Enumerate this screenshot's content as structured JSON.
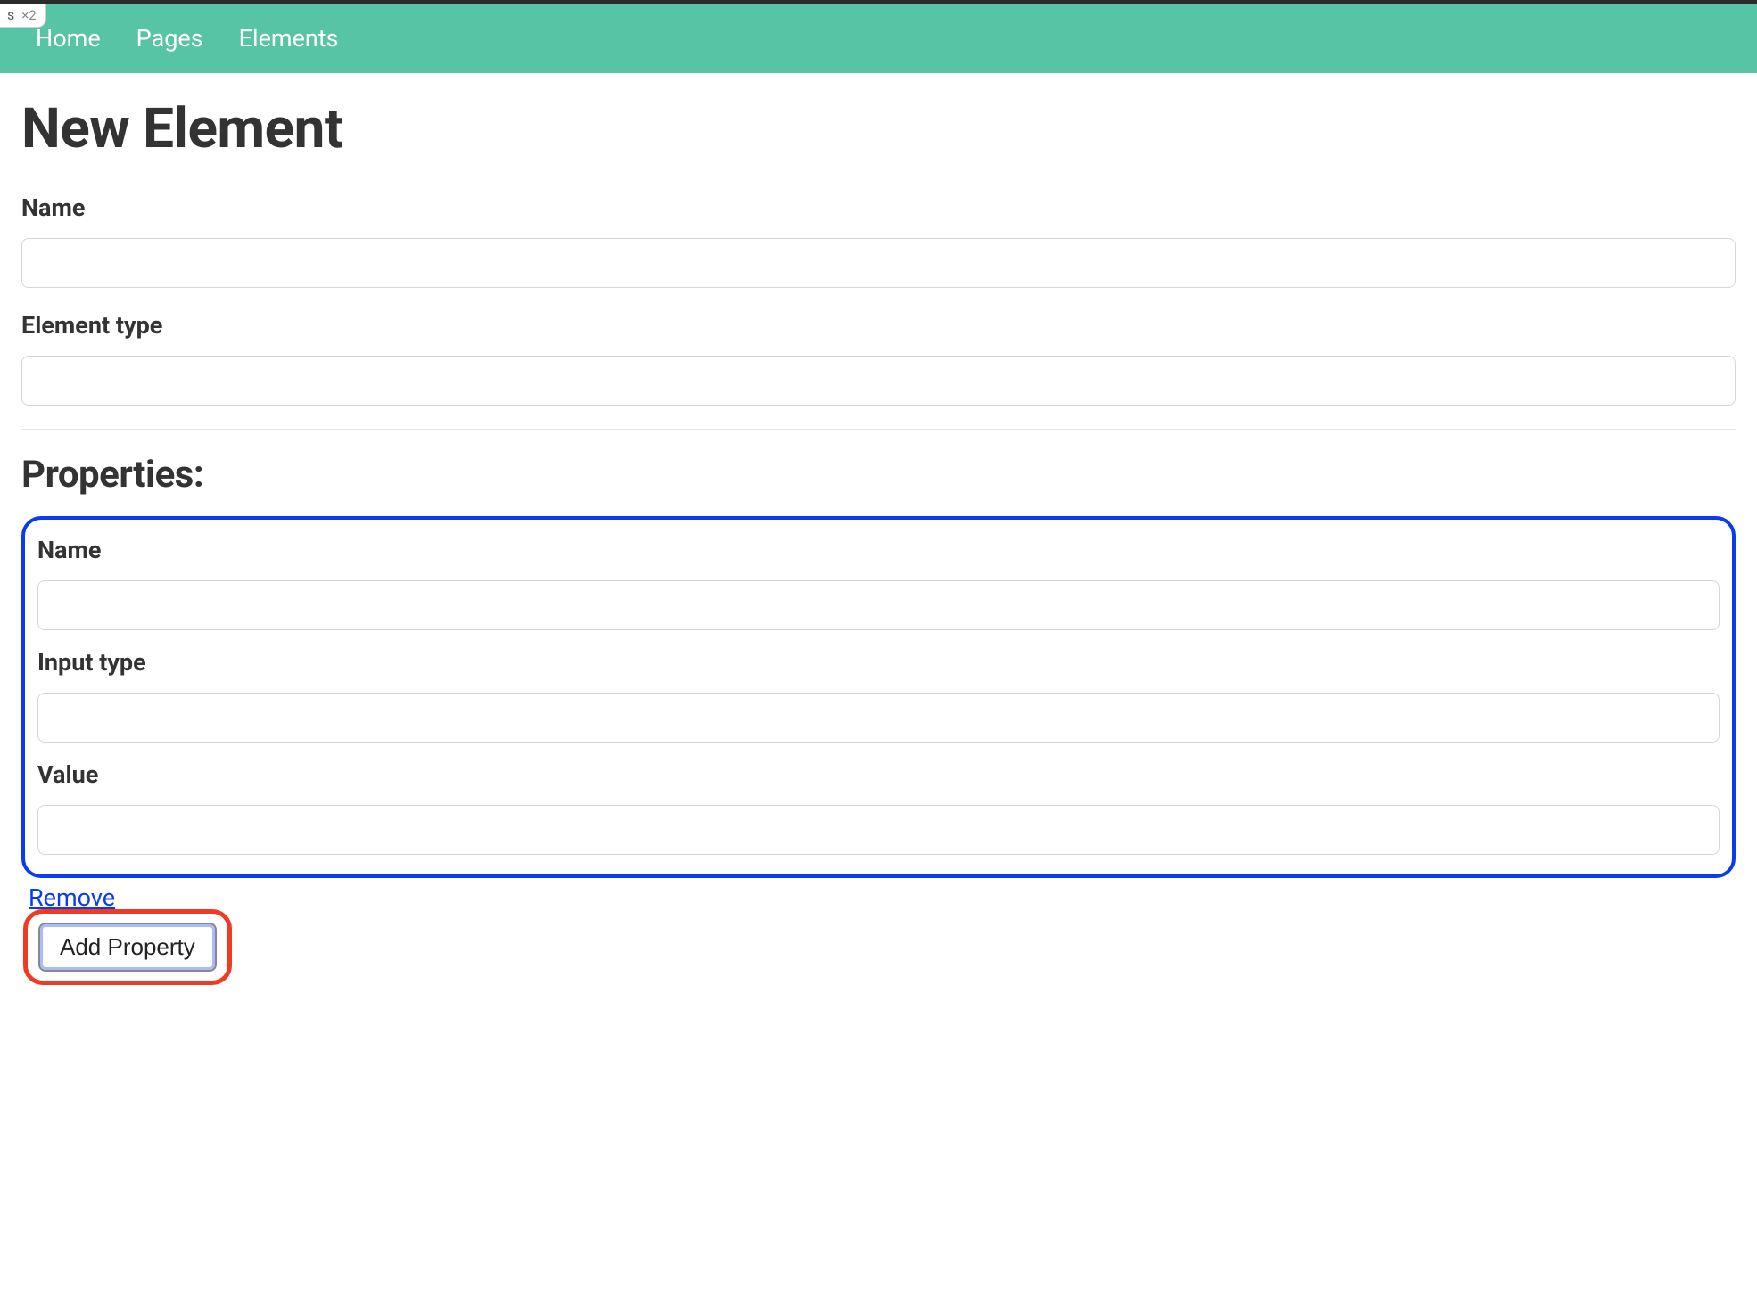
{
  "browserTab": {
    "label": "s",
    "badge": "×2"
  },
  "nav": {
    "items": [
      "Home",
      "Pages",
      "Elements"
    ]
  },
  "page": {
    "title": "New Element"
  },
  "form": {
    "name": {
      "label": "Name",
      "value": ""
    },
    "elementType": {
      "label": "Element type",
      "value": ""
    }
  },
  "properties": {
    "heading": "Properties:",
    "items": [
      {
        "name": {
          "label": "Name",
          "value": ""
        },
        "inputType": {
          "label": "Input type",
          "value": ""
        },
        "value": {
          "label": "Value",
          "value": ""
        },
        "removeLabel": "Remove"
      }
    ],
    "addButton": "Add Property"
  },
  "colors": {
    "navbar": "#57c4a5",
    "accentBlue": "#093bf0",
    "highlightRed": "#f03a24"
  }
}
